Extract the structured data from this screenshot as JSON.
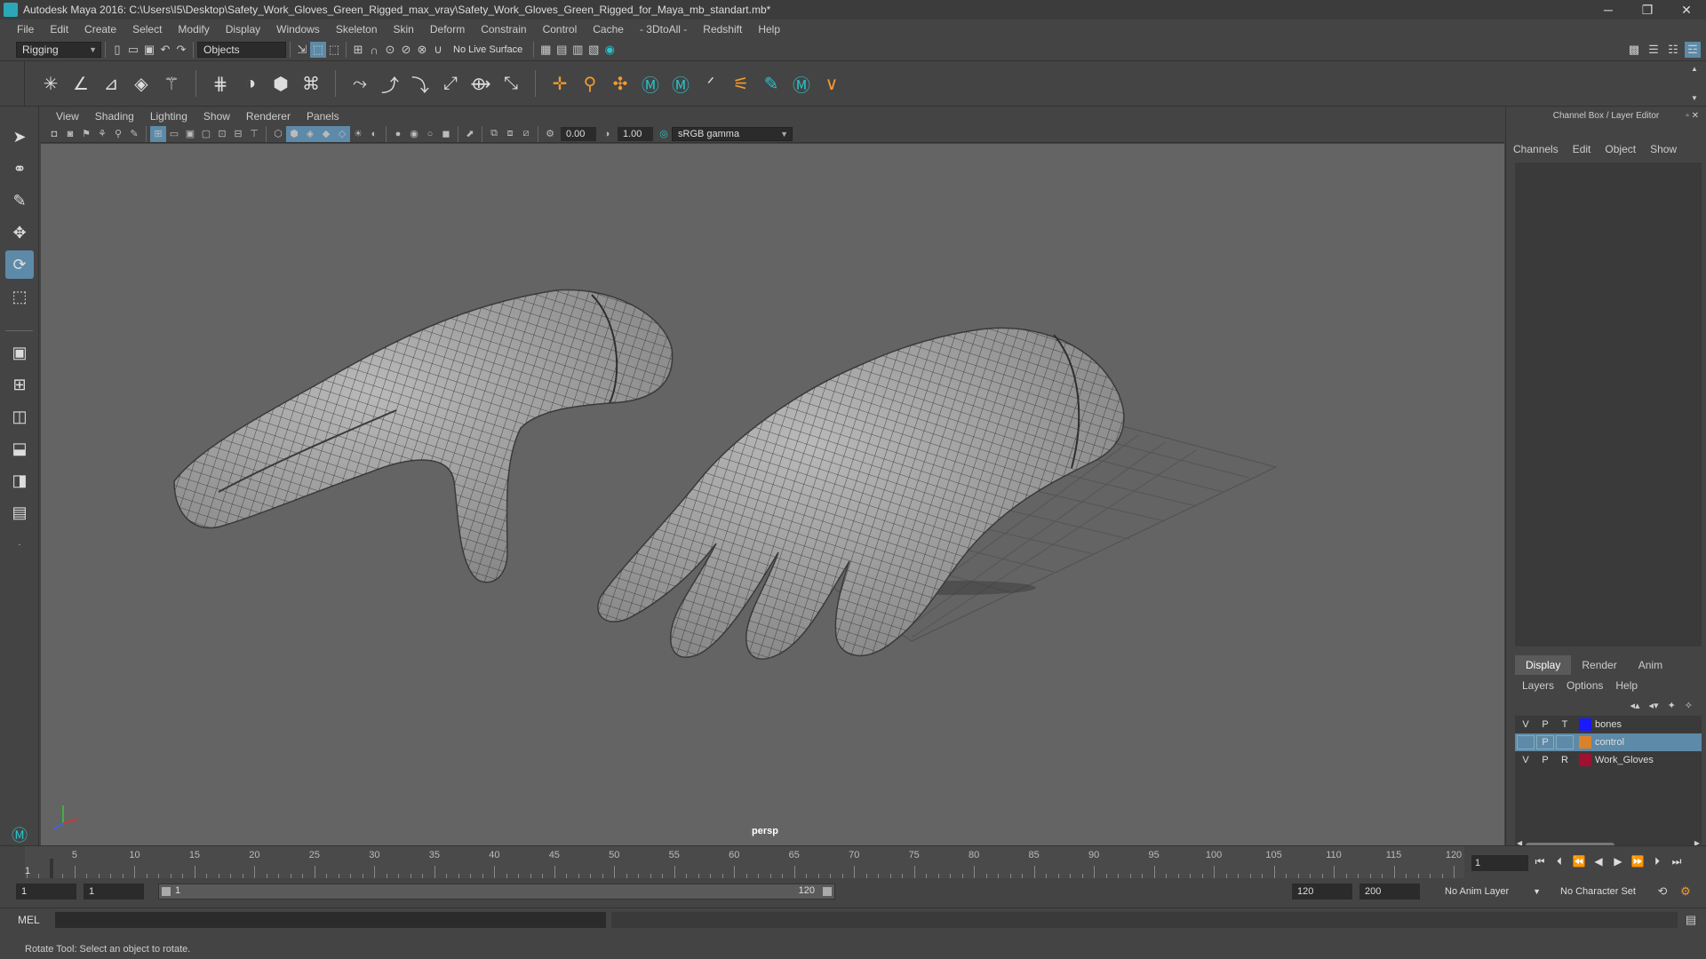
{
  "window": {
    "title": "Autodesk Maya 2016: C:\\Users\\I5\\Desktop\\Safety_Work_Gloves_Green_Rigged_max_vray\\Safety_Work_Gloves_Green_Rigged_for_Maya_mb_standart.mb*",
    "min": "─",
    "max": "❐",
    "close": "✕"
  },
  "menubar": [
    "File",
    "Edit",
    "Create",
    "Select",
    "Modify",
    "Display",
    "Windows",
    "Skeleton",
    "Skin",
    "Deform",
    "Constrain",
    "Control",
    "Cache",
    "- 3DtoAll -",
    "Redshift",
    "Help"
  ],
  "statusline": {
    "mode": "Rigging",
    "select_mode": "Objects",
    "live_surface": "No Live Surface"
  },
  "viewport": {
    "menu": [
      "View",
      "Shading",
      "Lighting",
      "Show",
      "Renderer",
      "Panels"
    ],
    "exposure": "0.00",
    "gamma": "1.00",
    "color_space": "sRGB gamma",
    "camera": "persp"
  },
  "right_panel": {
    "title": "Channel Box / Layer Editor",
    "cb_tabs": [
      "Channels",
      "Edit",
      "Object",
      "Show"
    ],
    "le_tabs": [
      "Display",
      "Render",
      "Anim"
    ],
    "le_menu": [
      "Layers",
      "Options",
      "Help"
    ],
    "layers": [
      {
        "v": "V",
        "p": "P",
        "t": "T",
        "color": "#1a1aff",
        "name": "bones",
        "selected": false
      },
      {
        "v": "",
        "p": "P",
        "t": "",
        "color": "#d9822b",
        "name": "control",
        "selected": true
      },
      {
        "v": "V",
        "p": "P",
        "t": "R",
        "color": "#a01030",
        "name": "Work_Gloves",
        "selected": false
      }
    ]
  },
  "timeline": {
    "ticks": [
      1,
      5,
      10,
      15,
      20,
      25,
      30,
      35,
      40,
      45,
      50,
      55,
      60,
      65,
      70,
      75,
      80,
      85,
      90,
      95,
      100,
      105,
      110,
      115,
      120
    ],
    "current_frame": "1",
    "frame_field": "1"
  },
  "range": {
    "start": "1",
    "playback_start": "1",
    "bar_left": "1",
    "bar_right": "120",
    "playback_end": "120",
    "end": "200",
    "anim_layer": "No Anim Layer",
    "char_set": "No Character Set"
  },
  "cmdline": {
    "label": "MEL"
  },
  "help": "Rotate Tool: Select an object to rotate.",
  "colors": {
    "accent": "#5d8aa8",
    "viewport_bg": "#646464"
  }
}
